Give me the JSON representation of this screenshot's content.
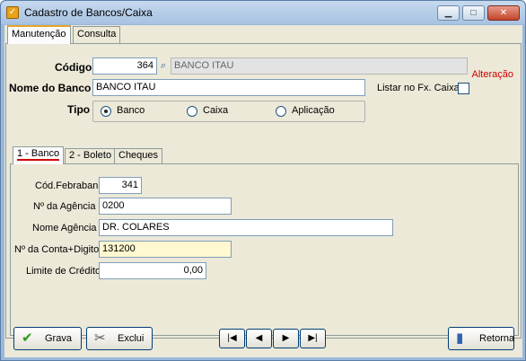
{
  "window": {
    "title": "Cadastro de Bancos/Caixa",
    "icon": "app-icon",
    "controls": [
      "minimize",
      "maximize",
      "close"
    ]
  },
  "top_tabs": [
    "Manutenção",
    "Consulta"
  ],
  "status": "Alteração",
  "form": {
    "codigo_label": "Código",
    "codigo_value": "364",
    "codigo_desc": "BANCO ITAU",
    "nome_label": "Nome do Banco",
    "nome_value": "BANCO ITAU",
    "listar_label": "Listar no Fx. Caixa",
    "tipo_label": "Tipo",
    "tipo_options": [
      "Banco",
      "Caixa",
      "Aplicação"
    ],
    "tipo_selected": "Banco"
  },
  "inner_tabs": [
    "1 - Banco",
    "2 - Boleto",
    "Cheques"
  ],
  "banco": {
    "febraban_label": "Cód.Febraban",
    "febraban_value": "341",
    "agencia_label": "Nº da Agência",
    "agencia_value": "0200",
    "nome_agencia_label": "Nome Agência",
    "nome_agencia_value": "DR. COLARES",
    "conta_label": "Nº da Conta+Digito",
    "conta_value": "131200",
    "limite_label": "Limite de Crédito",
    "limite_value": "0,00"
  },
  "buttons": {
    "grava": "Grava",
    "exclui": "Exclui",
    "retorna": "Retorna",
    "nav_first": "|◀",
    "nav_prev": "◀",
    "nav_next": "▶",
    "nav_last": "▶|"
  },
  "colors": {
    "status": "#d00000",
    "highlight_field": "#fff8d0",
    "tab_accent": "#e6a42c"
  }
}
